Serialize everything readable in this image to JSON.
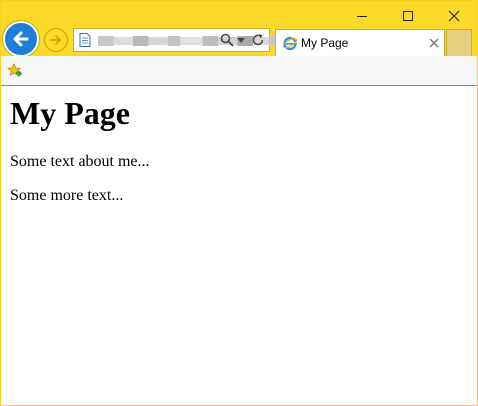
{
  "window": {
    "controls": [
      "minimize",
      "maximize",
      "close"
    ]
  },
  "navigation": {
    "back_icon": "back-arrow-icon",
    "forward_icon": "forward-arrow-icon"
  },
  "address_bar": {
    "url": "",
    "page_icon": "page-icon",
    "search_icon": "search-icon",
    "dropdown_icon": "chevron-down-icon",
    "refresh_icon": "refresh-icon"
  },
  "tab": {
    "title": "My Page",
    "icon": "ie-logo-icon",
    "close_icon": "close-icon"
  },
  "favorites_bar": {
    "icon": "add-favorite-icon"
  },
  "page": {
    "heading": "My Page",
    "paragraphs": [
      "Some text about me...",
      "Some more text..."
    ]
  },
  "colors": {
    "chrome": "#fbd929",
    "back_button": "#1e7dd6",
    "favorites_bar": "#f6f6f6"
  }
}
